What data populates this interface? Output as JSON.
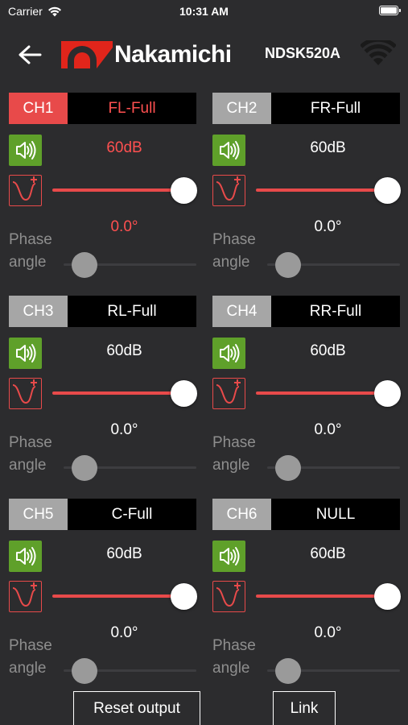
{
  "status_bar": {
    "carrier": "Carrier",
    "time": "10:31 AM"
  },
  "header": {
    "brand": "Nakamichi",
    "device": "NDSK520A"
  },
  "phase_label": "Phase angle",
  "channels": [
    {
      "label": "CH1",
      "name": "FL-Full",
      "level": "60dB",
      "phase": "0.0°",
      "active": true,
      "volume_fraction": 1.0,
      "phase_fraction": 0.0
    },
    {
      "label": "CH2",
      "name": "FR-Full",
      "level": "60dB",
      "phase": "0.0°",
      "active": false,
      "volume_fraction": 1.0,
      "phase_fraction": 0.0
    },
    {
      "label": "CH3",
      "name": "RL-Full",
      "level": "60dB",
      "phase": "0.0°",
      "active": false,
      "volume_fraction": 1.0,
      "phase_fraction": 0.0
    },
    {
      "label": "CH4",
      "name": "RR-Full",
      "level": "60dB",
      "phase": "0.0°",
      "active": false,
      "volume_fraction": 1.0,
      "phase_fraction": 0.0
    },
    {
      "label": "CH5",
      "name": "C-Full",
      "level": "60dB",
      "phase": "0.0°",
      "active": false,
      "volume_fraction": 1.0,
      "phase_fraction": 0.0
    },
    {
      "label": "CH6",
      "name": "NULL",
      "level": "60dB",
      "phase": "0.0°",
      "active": false,
      "volume_fraction": 1.0,
      "phase_fraction": 0.0
    }
  ],
  "buttons": {
    "reset": "Reset output",
    "link": "Link"
  },
  "icons": {
    "back": "back-arrow-icon",
    "wifi": "wifi-icon",
    "speaker": "speaker-icon",
    "eq": "eq-curve-icon"
  },
  "colors": {
    "accent": "#e84a4a",
    "speaker_bg": "#5fa02a",
    "inactive_label": "#a6a6a6",
    "background": "#2c2c2e"
  }
}
